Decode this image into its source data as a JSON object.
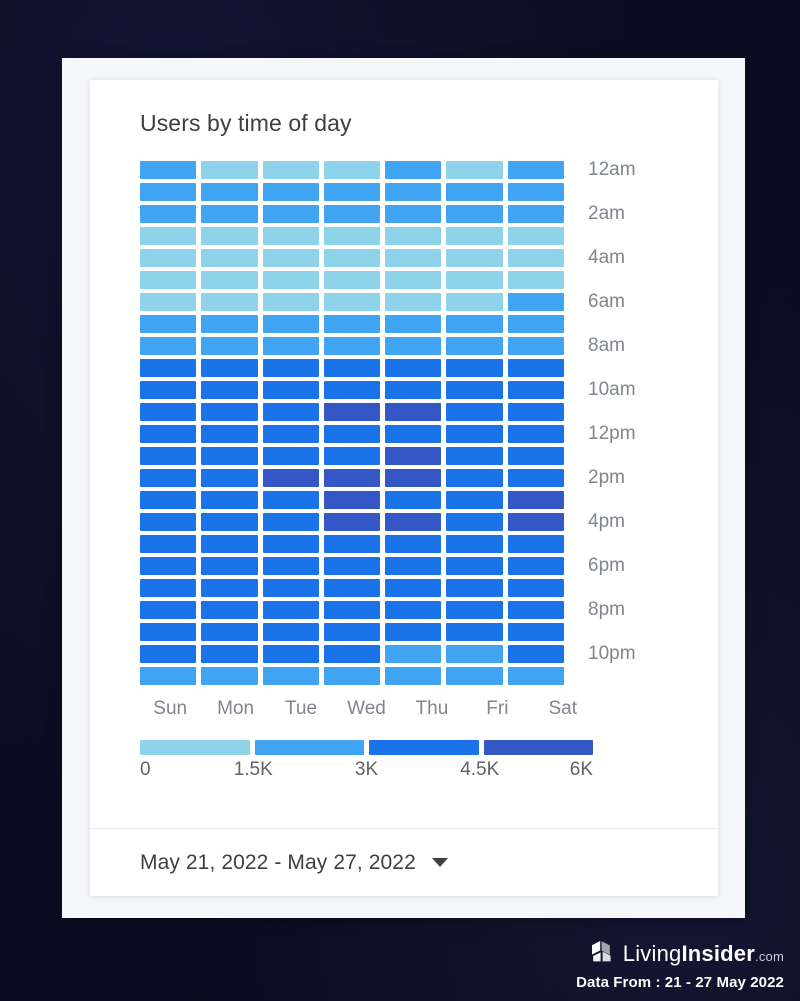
{
  "chart_data": {
    "type": "heatmap",
    "title": "Users by time of day",
    "xlabel": "",
    "ylabel": "",
    "x_categories": [
      "Sun",
      "Mon",
      "Tue",
      "Wed",
      "Thu",
      "Fri",
      "Sat"
    ],
    "y_categories": [
      "12am",
      "1am",
      "2am",
      "3am",
      "4am",
      "5am",
      "6am",
      "7am",
      "8am",
      "9am",
      "10am",
      "11am",
      "12pm",
      "1pm",
      "2pm",
      "3pm",
      "4pm",
      "5pm",
      "6pm",
      "7pm",
      "8pm",
      "9pm",
      "10pm",
      "11pm"
    ],
    "y_tick_labels": [
      "12am",
      "2am",
      "4am",
      "6am",
      "8am",
      "10am",
      "12pm",
      "2pm",
      "4pm",
      "6pm",
      "8pm",
      "10pm"
    ],
    "legend": {
      "position": "bottom",
      "ticks": [
        "0",
        "1.5K",
        "3K",
        "4.5K",
        "6K"
      ],
      "bands": [
        {
          "label": "0 - 1.5K",
          "color": "#8fd3ea"
        },
        {
          "label": "1.5K - 3K",
          "color": "#41a4f3"
        },
        {
          "label": "3K - 4.5K",
          "color": "#1a73e8"
        },
        {
          "label": "4.5K - 6K",
          "color": "#3457c5"
        }
      ],
      "min": 0,
      "max": 6000
    },
    "levels": [
      [
        2,
        1,
        1,
        1,
        2,
        1,
        2
      ],
      [
        2,
        2,
        2,
        2,
        2,
        2,
        2
      ],
      [
        2,
        2,
        2,
        2,
        2,
        2,
        2
      ],
      [
        1,
        1,
        1,
        1,
        1,
        1,
        1
      ],
      [
        1,
        1,
        1,
        1,
        1,
        1,
        1
      ],
      [
        1,
        1,
        1,
        1,
        1,
        1,
        1
      ],
      [
        1,
        1,
        1,
        1,
        1,
        1,
        2
      ],
      [
        2,
        2,
        2,
        2,
        2,
        2,
        2
      ],
      [
        2,
        2,
        2,
        2,
        2,
        2,
        2
      ],
      [
        3,
        3,
        3,
        3,
        3,
        3,
        3
      ],
      [
        3,
        3,
        3,
        3,
        3,
        3,
        3
      ],
      [
        3,
        3,
        3,
        4,
        4,
        3,
        3
      ],
      [
        3,
        3,
        3,
        3,
        3,
        3,
        3
      ],
      [
        3,
        3,
        3,
        3,
        4,
        3,
        3
      ],
      [
        3,
        3,
        4,
        4,
        4,
        3,
        3
      ],
      [
        3,
        3,
        3,
        4,
        3,
        3,
        4
      ],
      [
        3,
        3,
        3,
        4,
        4,
        3,
        4
      ],
      [
        3,
        3,
        3,
        3,
        3,
        3,
        3
      ],
      [
        3,
        3,
        3,
        3,
        3,
        3,
        3
      ],
      [
        3,
        3,
        3,
        3,
        3,
        3,
        3
      ],
      [
        3,
        3,
        3,
        3,
        3,
        3,
        3
      ],
      [
        3,
        3,
        3,
        3,
        3,
        3,
        3
      ],
      [
        3,
        3,
        3,
        3,
        2,
        2,
        3
      ],
      [
        2,
        2,
        2,
        2,
        2,
        2,
        2
      ]
    ]
  },
  "footer": {
    "date_range": "May 21, 2022 - May 27, 2022",
    "caret_icon": "chevron-down-icon"
  },
  "brand": {
    "logo_icon": "house-cube-logo-icon",
    "name_light": "Living",
    "name_bold": "Insider",
    "name_tld": ".com",
    "data_from": "Data From : 21 - 27 May 2022"
  }
}
